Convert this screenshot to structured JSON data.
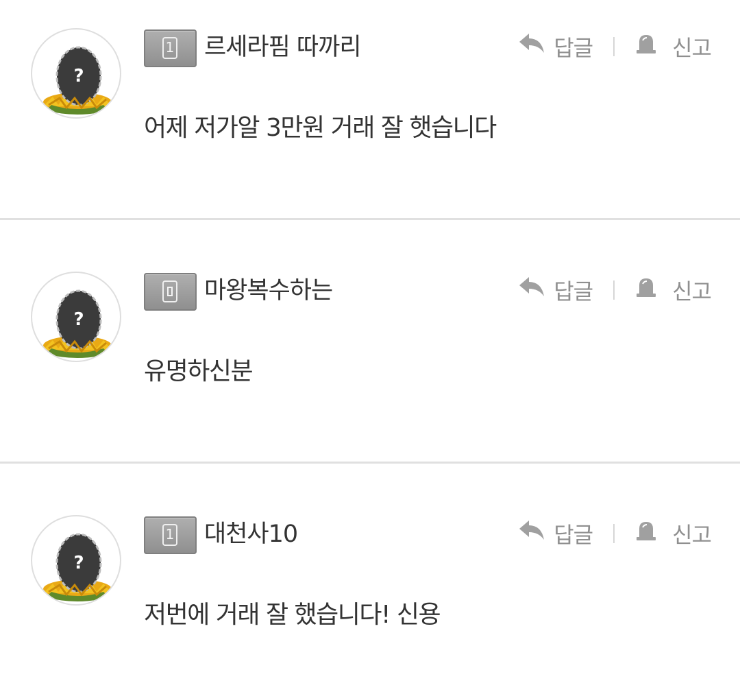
{
  "comments": [
    {
      "level": "1",
      "author": "르세라핌 따까리",
      "text": "어제 저가알 3만원 거래 잘 햇습니다",
      "reply_label": "답글",
      "report_label": "신고"
    },
    {
      "level": "0",
      "author": "마왕복수하는",
      "text": "유명하신분",
      "reply_label": "답글",
      "report_label": "신고"
    },
    {
      "level": "1",
      "author": "대천사10",
      "text": "저번에 거래 잘 했습니다! 신용",
      "reply_label": "답글",
      "report_label": "신고"
    }
  ],
  "icons": {
    "avatar": "egg-question-icon",
    "reply": "reply-arrow-icon",
    "report": "siren-icon"
  },
  "colors": {
    "action_text": "#8f8f8f",
    "badge": "#9e9e9e",
    "divider": "#e0e0e0",
    "text": "#333333"
  }
}
